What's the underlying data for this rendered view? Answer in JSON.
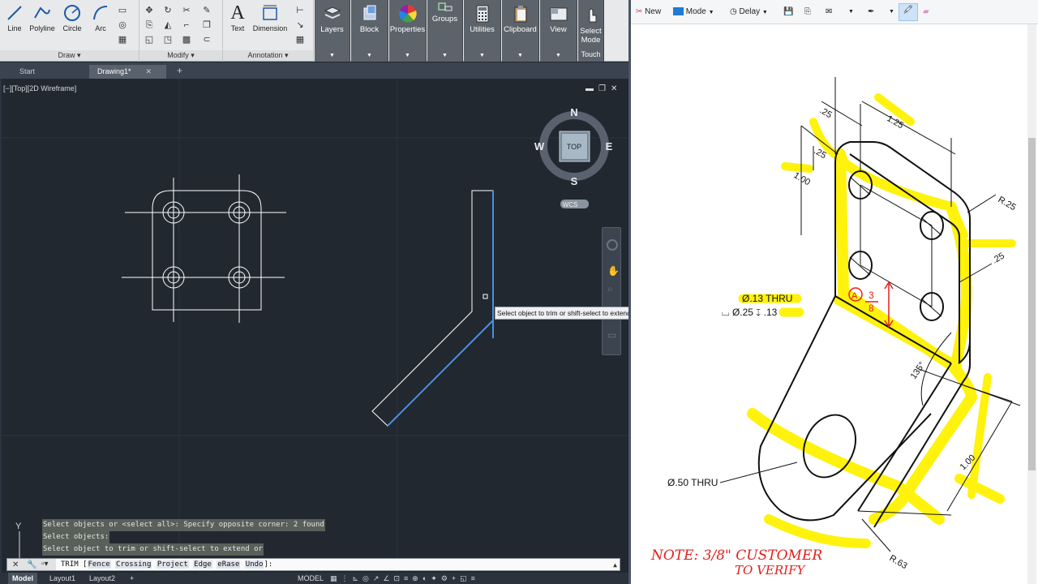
{
  "acad": {
    "ribbon": {
      "draw": {
        "title": "Draw",
        "line": "Line",
        "polyline": "Polyline",
        "circle": "Circle",
        "arc": "Arc"
      },
      "modify": {
        "title": "Modify"
      },
      "annotation": {
        "title": "Annotation",
        "text": "Text",
        "dimension": "Dimension"
      },
      "layers": "Layers",
      "block": "Block",
      "properties": "Properties",
      "groups": "Groups",
      "utilities": "Utilities",
      "clipboard": "Clipboard",
      "view": "View",
      "select_mode": "Select Mode",
      "touch": "Touch"
    },
    "file_tabs": {
      "start": "Start",
      "drawing": "Drawing1*"
    },
    "viewport_label": "[−][Top][2D Wireframe]",
    "viewcube": {
      "top": "TOP",
      "n": "N",
      "s": "S",
      "e": "E",
      "w": "W",
      "wcs": "WCS"
    },
    "tooltip": "Select object to trim or shift-select to extend or",
    "command_history": [
      "Select objects or <select all>: Specify opposite corner: 2 found",
      "Select objects:",
      "Select object to trim or shift-select to extend or"
    ],
    "command_line": {
      "prefix": "TRIM [",
      "options": [
        "Fence",
        "Crossing",
        "Project",
        "Edge",
        "eRase",
        "Undo"
      ],
      "suffix": "]:"
    },
    "ucs_label": "Y",
    "status": {
      "model": "Model",
      "layout1": "Layout1",
      "layout2": "Layout2",
      "model_indicator": "MODEL"
    },
    "colors": {
      "background": "#212830",
      "selection": "#4d8fe0",
      "lines": "#ffffff"
    }
  },
  "snip": {
    "toolbar": {
      "new": "New",
      "mode": "Mode",
      "delay": "Delay"
    },
    "drawing": {
      "dims": {
        "d025_top": ".25",
        "d125": "1.25",
        "d025_side": ".25",
        "d100_left": "1.00",
        "r025": "R.25",
        "d025_right": ".25",
        "angle": "135°",
        "d100_bottom": "1.00",
        "r063": "R.63"
      },
      "callouts": {
        "hole_small": "Ø.13 THRU",
        "cbore_prefix": "Ø.25",
        "cbore_depth": ".13",
        "hole_large": "Ø.50 THRU"
      },
      "handwriting": {
        "fraction_num": "3",
        "fraction_den": "8",
        "note_line1": "NOTE: 3/8\" CUSTOMER",
        "note_line2": "TO VERIFY",
        "circle_a": "A"
      },
      "colors": {
        "highlight": "#fff200",
        "ink": "#e0201b",
        "line": "#111111"
      }
    }
  }
}
